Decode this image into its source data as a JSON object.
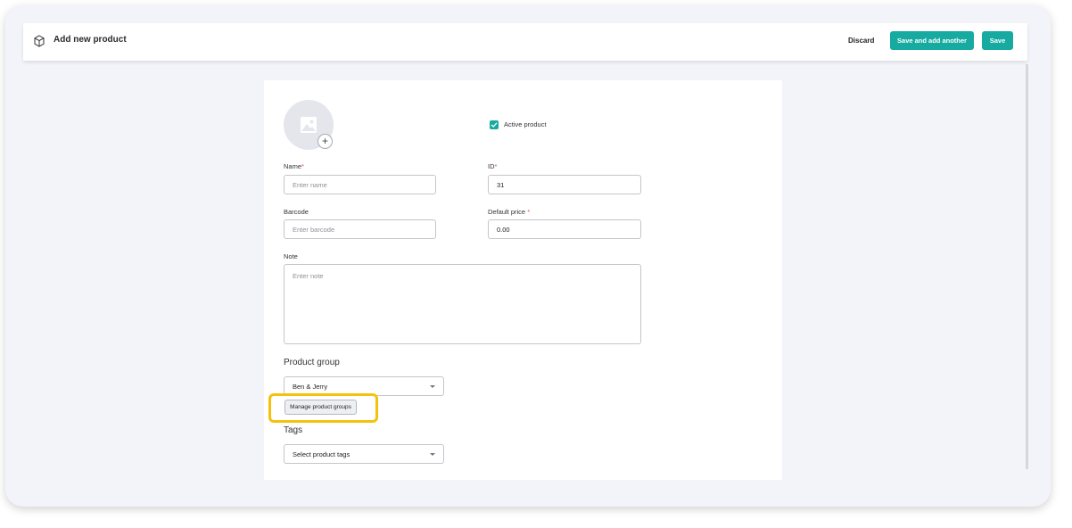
{
  "header": {
    "title": "Add new product",
    "icon": "box-icon",
    "discard_label": "Discard",
    "save_another_label": "Save and add another",
    "save_label": "Save",
    "accent_color": "#16aaa0"
  },
  "form": {
    "active_label": "Active product",
    "active_checked": true,
    "name": {
      "label": "Name",
      "required_mark": "*",
      "placeholder": "Enter name",
      "value": ""
    },
    "id": {
      "label": "ID",
      "required_mark": "*",
      "value": "31"
    },
    "barcode": {
      "label": "Barcode",
      "placeholder": "Enter barcode",
      "value": ""
    },
    "default_price": {
      "label": "Default price",
      "required_mark": "*",
      "value": "0.00"
    },
    "note": {
      "label": "Note",
      "placeholder": "Enter note"
    },
    "product_group": {
      "heading": "Product group",
      "selected": "Ben & Jerry",
      "manage_label": "Manage product groups"
    },
    "tags": {
      "heading": "Tags",
      "placeholder": "Select product tags"
    }
  },
  "highlight_color": "#f4c20d"
}
